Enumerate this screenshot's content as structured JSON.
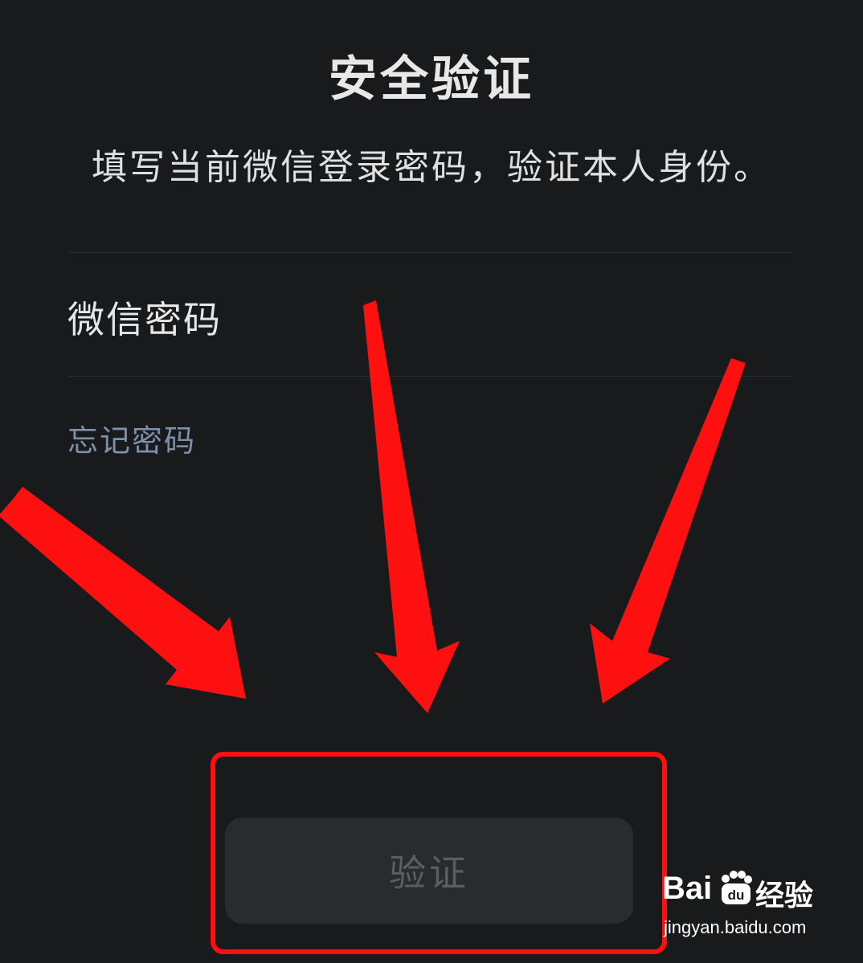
{
  "header": {
    "title": "安全验证",
    "subtitle": "填写当前微信登录密码，验证本人身份。"
  },
  "form": {
    "password_label": "微信密码",
    "password_value": "",
    "password_placeholder": "",
    "forgot_password_link": "忘记密码"
  },
  "actions": {
    "verify_label": "验证"
  },
  "annotations": {
    "arrow_color": "#ff1010",
    "highlight_color": "#ff1010"
  },
  "watermark": {
    "brand_latin": "Bai",
    "brand_du": "du",
    "brand_cn": "经验",
    "url": "jingyan.baidu.com"
  },
  "colors": {
    "background": "#181a1c",
    "link": "#7d90aa",
    "button_bg": "#292b2e",
    "button_text_disabled": "#5b5d60"
  }
}
